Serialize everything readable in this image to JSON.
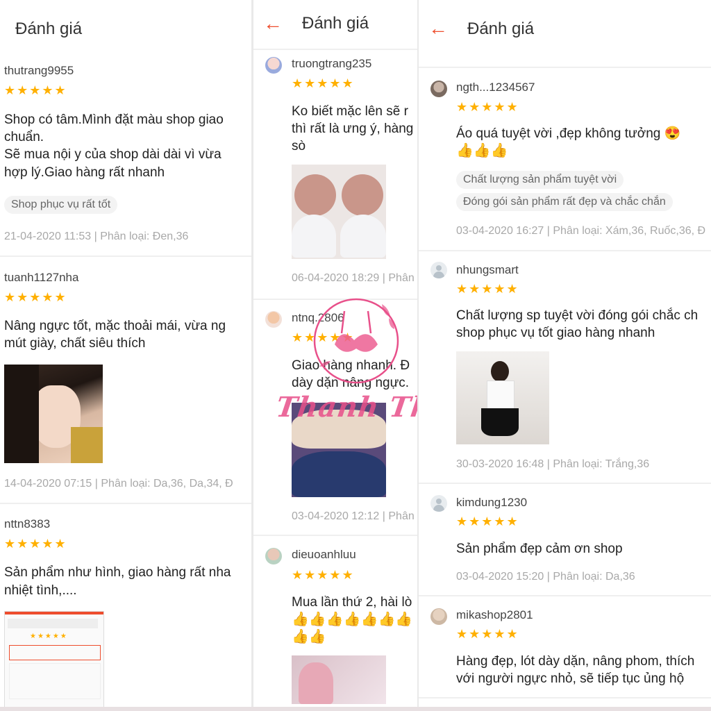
{
  "panel1": {
    "header_title": "Đánh giá",
    "reviews": [
      {
        "user": "thutrang9955",
        "stars": "★★★★★",
        "text_lines": [
          "Shop có tâm.Mình đặt màu shop giao",
          "chuẩn.",
          "Sẽ mua nội y của shop dài dài vì vừa",
          "hợp lý.Giao hàng rất nhanh"
        ],
        "tags": [
          "Shop phục vụ rất tốt"
        ],
        "meta": "21-04-2020 11:53 | Phân loại: Đen,36"
      },
      {
        "user": "tuanh1127nha",
        "stars": "★★★★★",
        "text_lines": [
          "Nâng ngực tốt, mặc thoải mái, vừa ng",
          "mút giày, chất siêu thích"
        ],
        "meta": "14-04-2020 07:15 | Phân loại: Da,36, Da,34, Đ"
      },
      {
        "user": "nttn8383",
        "stars": "★★★★★",
        "text_lines": [
          "Sản phẩm như hình, giao hàng rất nha",
          "nhiệt tình,...."
        ]
      }
    ]
  },
  "panel2": {
    "header_back": "←",
    "header_title": "Đánh giá",
    "reviews": [
      {
        "user": "truongtrang235",
        "stars": "★★★★★",
        "text_lines": [
          "Ko biết mặc lên sẽ r",
          "thì rất là ưng ý, hàng",
          "sò"
        ],
        "meta": "06-04-2020 18:29 | Phân"
      },
      {
        "user": "ntnq.2806",
        "stars": "★★★★★",
        "text_lines": [
          "Giao hàng nhanh. Đ",
          "dày dặn nâng ngực."
        ],
        "meta": "03-04-2020 12:12 | Phân"
      },
      {
        "user": "dieuoanhluu",
        "stars": "★★★★★",
        "text_lines": [
          "Mua lần thứ 2, hài lò"
        ],
        "emoji_lines": [
          "👍👍👍👍👍👍👍",
          "👍👍"
        ]
      }
    ],
    "watermark": "Thanh Thanh Bra"
  },
  "panel3": {
    "header_back": "←",
    "header_title": "Đánh giá",
    "reviews": [
      {
        "user": "ngth...1234567",
        "stars": "★★★★★",
        "text_lines": [
          "Áo quá tuyệt vời ,đẹp không tưởng 😍",
          "👍👍👍"
        ],
        "tags": [
          "Chất lượng sản phẩm tuyệt vời",
          "Đóng gói sản phẩm rất đẹp và chắc chắn"
        ],
        "meta": "03-04-2020 16:27 | Phân loại: Xám,36, Ruốc,36, Đ"
      },
      {
        "user": "nhungsmart",
        "stars": "★★★★★",
        "text_lines": [
          "Chất lượng sp tuyệt vời đóng gói chắc ch",
          "shop phục vụ tốt giao hàng nhanh"
        ],
        "meta": "30-03-2020 16:48 | Phân loại: Trắng,36"
      },
      {
        "user": "kimdung1230",
        "stars": "★★★★★",
        "text_lines": [
          "Sản phẩm đẹp cảm ơn shop"
        ],
        "meta": "03-04-2020 15:20 | Phân loại: Da,36"
      },
      {
        "user": "mikashop2801",
        "stars": "★★★★★",
        "text_lines": [
          "Hàng đẹp, lót dày dặn, nâng phom, thích",
          "với người ngực nhỏ, sẽ tiếp tục ủng hộ"
        ]
      }
    ]
  },
  "colors": {
    "accent": "#ee4d2d",
    "star": "#ffb000",
    "meta": "#a8a8a8",
    "watermark": "#e8508a"
  }
}
